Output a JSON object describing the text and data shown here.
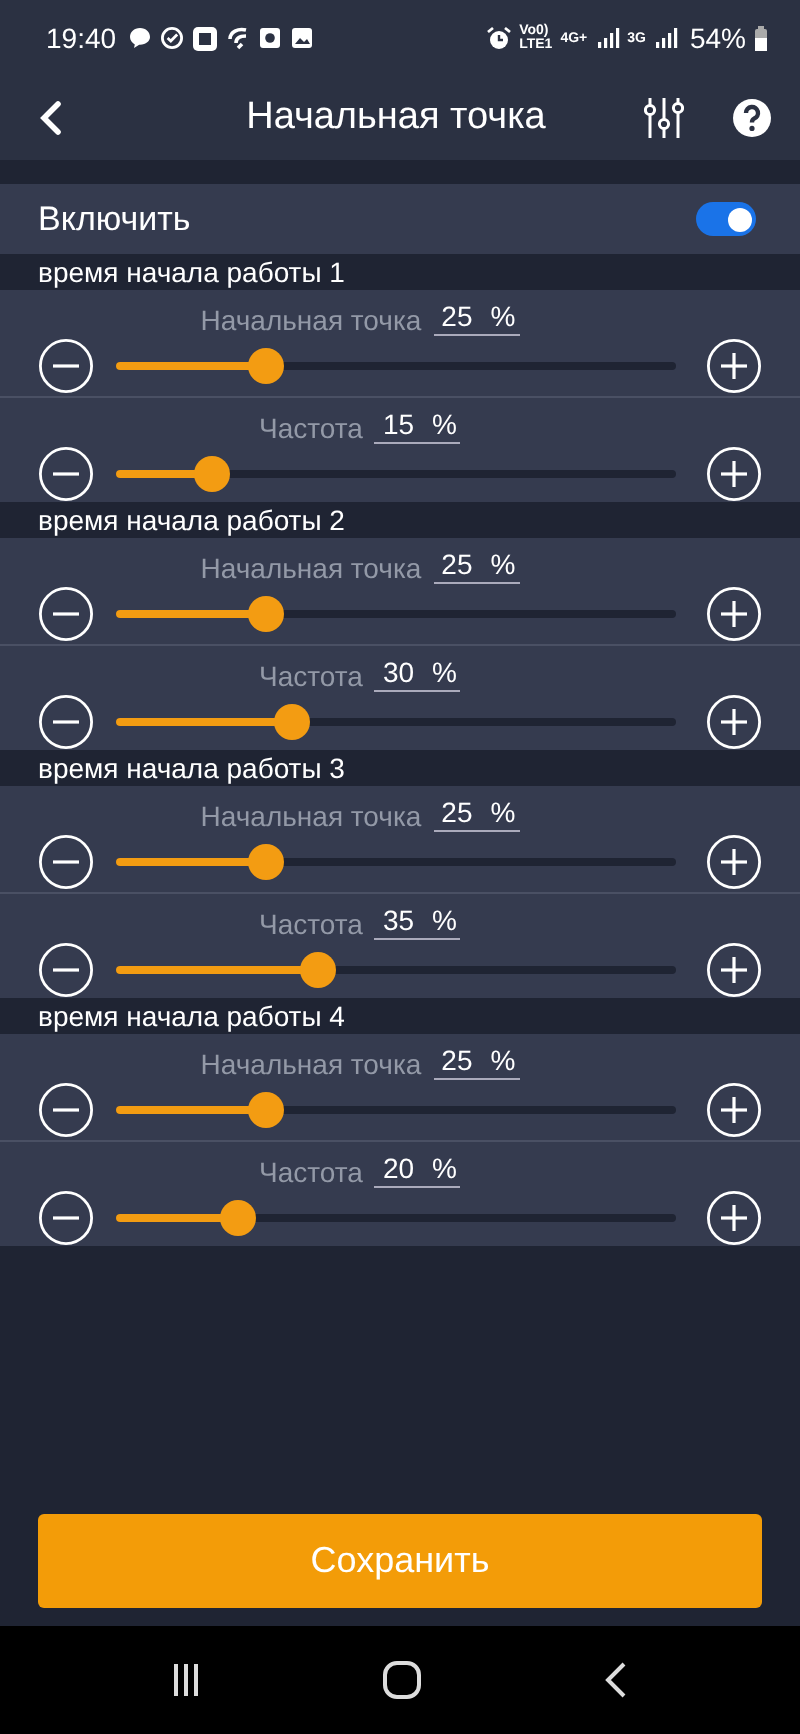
{
  "status_bar": {
    "time": "19:40",
    "volte_top": "Vo0)",
    "volte_bottom": "LTE1",
    "network_1": "4G+",
    "network_2": "3G",
    "battery": "54%"
  },
  "header": {
    "title": "Начальная точка"
  },
  "enable": {
    "label": "Включить",
    "on": true
  },
  "sections": [
    {
      "title": "время начала работы 1",
      "sliders": [
        {
          "label": "Начальная точка",
          "value": "25",
          "unit": "%",
          "level": 0.25
        },
        {
          "label": "Частота",
          "value": "15",
          "unit": "%",
          "level": 0.15
        }
      ]
    },
    {
      "title": "время начала работы 2",
      "sliders": [
        {
          "label": "Начальная точка",
          "value": "25",
          "unit": "%",
          "level": 0.25
        },
        {
          "label": "Частота",
          "value": "30",
          "unit": "%",
          "level": 0.3
        }
      ]
    },
    {
      "title": "время начала работы 3",
      "sliders": [
        {
          "label": "Начальная точка",
          "value": "25",
          "unit": "%",
          "level": 0.25
        },
        {
          "label": "Частота",
          "value": "35",
          "unit": "%",
          "level": 0.35
        }
      ]
    },
    {
      "title": "время начала работы 4",
      "sliders": [
        {
          "label": "Начальная точка",
          "value": "25",
          "unit": "%",
          "level": 0.25
        },
        {
          "label": "Частота",
          "value": "20",
          "unit": "%",
          "level": 0.2
        }
      ]
    }
  ],
  "save_button": "Сохранить"
}
